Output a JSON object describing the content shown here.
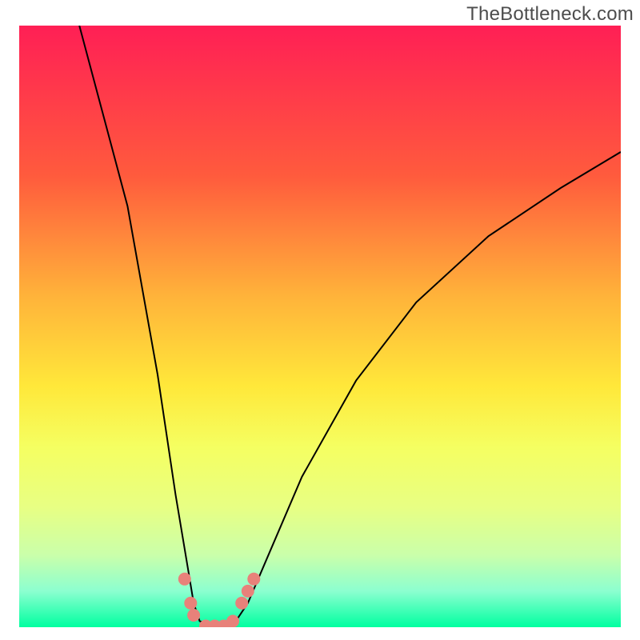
{
  "attribution": "TheBottleneck.com",
  "chart_data": {
    "type": "line",
    "title": "",
    "xlabel": "",
    "ylabel": "",
    "ylim": [
      0,
      100
    ],
    "xlim": [
      0,
      100
    ],
    "background_gradient": {
      "top": "#ff1f55",
      "bottom": "#00ffa0"
    },
    "series": [
      {
        "name": "bottleneck-curve",
        "points": [
          {
            "x": 10,
            "y": 100
          },
          {
            "x": 18,
            "y": 70
          },
          {
            "x": 23,
            "y": 42
          },
          {
            "x": 26,
            "y": 22
          },
          {
            "x": 28,
            "y": 10
          },
          {
            "x": 29,
            "y": 4
          },
          {
            "x": 30,
            "y": 1
          },
          {
            "x": 33,
            "y": 0
          },
          {
            "x": 36,
            "y": 1
          },
          {
            "x": 38,
            "y": 4
          },
          {
            "x": 41,
            "y": 11
          },
          {
            "x": 47,
            "y": 25
          },
          {
            "x": 56,
            "y": 41
          },
          {
            "x": 66,
            "y": 54
          },
          {
            "x": 78,
            "y": 65
          },
          {
            "x": 90,
            "y": 73
          },
          {
            "x": 100,
            "y": 79
          }
        ]
      }
    ],
    "markers": [
      {
        "x": 27.5,
        "y": 8
      },
      {
        "x": 28.5,
        "y": 4
      },
      {
        "x": 29.0,
        "y": 2
      },
      {
        "x": 31.0,
        "y": 0.2
      },
      {
        "x": 32.5,
        "y": 0.2
      },
      {
        "x": 34.0,
        "y": 0.2
      },
      {
        "x": 35.5,
        "y": 1
      },
      {
        "x": 37.0,
        "y": 4
      },
      {
        "x": 38.0,
        "y": 6
      },
      {
        "x": 39.0,
        "y": 8
      }
    ]
  }
}
